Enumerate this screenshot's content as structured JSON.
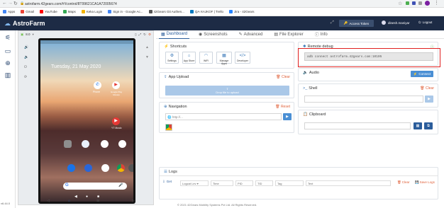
{
  "browser": {
    "url": "astrofarm.42gears.com/#!/control/8T99621CA1A72005674",
    "bookmarks": [
      "Apps",
      "Gmail",
      "YouTube",
      "Maps",
      "Keka Login",
      "Sign in - Google Ac...",
      "42Gears Git Authen...",
      "QA-XAJKOF | Trello",
      "Jira - 42Gears"
    ]
  },
  "app": {
    "brand": "AstroFarm",
    "access_token_label": "Access Token",
    "user_name": "dinesh.maniyar",
    "logout_label": "Logout"
  },
  "device": {
    "version_label": "8.0",
    "phone_time": "Tuesday, 21 May 2020",
    "apps": [
      {
        "label": "Phone",
        "color": "#ffffff"
      },
      {
        "label": "Google Play Movies",
        "color": "#ffffff"
      },
      {
        "label": "YT Music",
        "color": "#e53935"
      }
    ],
    "footer_label": "v6.44.0"
  },
  "tabs": [
    {
      "label": "Dashboard",
      "icon": "dashboard-icon",
      "active": true
    },
    {
      "label": "Screenshots",
      "icon": "camera-icon",
      "active": false
    },
    {
      "label": "Advanced",
      "icon": "wrench-icon",
      "active": false
    },
    {
      "label": "File Explorer",
      "icon": "folder-icon",
      "active": false
    },
    {
      "label": "Info",
      "icon": "info-icon",
      "active": false
    }
  ],
  "shortcuts": {
    "title": "Shortcuts",
    "items": [
      "Settings",
      "App Store",
      "WiFi",
      "Manage Apps",
      "Developer"
    ]
  },
  "app_upload": {
    "title": "App Upload",
    "clear_label": "Clear",
    "drop_text": "Drop file to upload"
  },
  "navigation": {
    "title": "Navigation",
    "reset_label": "Reset",
    "url_placeholder": "http://..."
  },
  "remote_debug": {
    "title": "Remote debug",
    "command": "adb connect astrofarm.42gears.com:10105"
  },
  "audio": {
    "title": "Audio",
    "connect_label": "Connect"
  },
  "shell": {
    "title": "Shell",
    "clear_label": "Clear"
  },
  "clipboard": {
    "title": "Clipboard"
  },
  "logs": {
    "title": "Logs",
    "get_label": "Get",
    "level_label": "Logcat Lev",
    "columns": [
      "Time",
      "PID",
      "TID",
      "Tag",
      "Text"
    ],
    "clear_label": "Clear",
    "save_label": "Save Logs"
  },
  "footer": "© 2021 42Gears Mobility Systems Pvt Ltd. All Rights Reserved.",
  "colors": {
    "header_bg": "#1d2b45",
    "accent": "#4a8fd4",
    "highlight": "#e02020"
  }
}
